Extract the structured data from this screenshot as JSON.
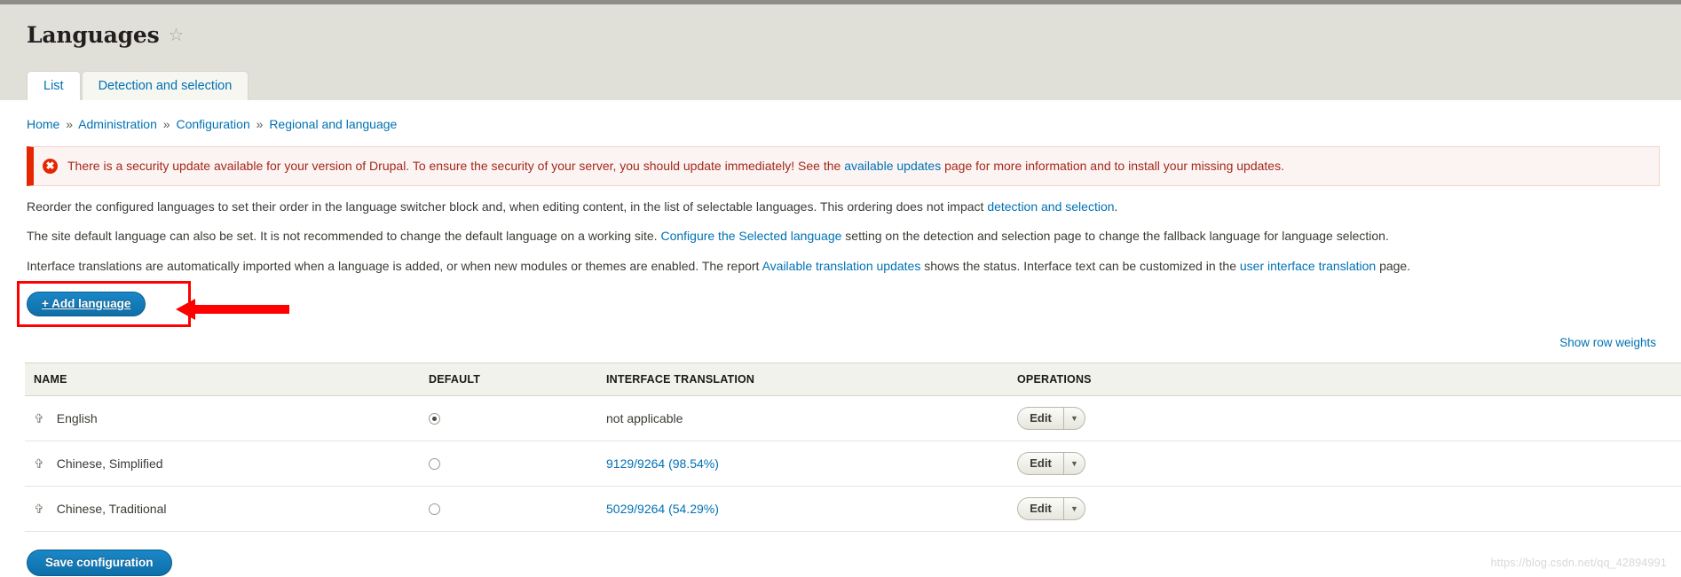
{
  "header": {
    "title": "Languages",
    "star_icon": "star-outline-icon"
  },
  "tabs": [
    {
      "label": "List",
      "active": true
    },
    {
      "label": "Detection and selection",
      "active": false
    }
  ],
  "breadcrumb": {
    "items": [
      "Home",
      "Administration",
      "Configuration",
      "Regional and language"
    ],
    "separator": "»"
  },
  "message": {
    "icon": "error-icon",
    "text_before": "There is a security update available for your version of Drupal. To ensure the security of your server, you should update immediately! See the ",
    "link": "available updates",
    "text_after": " page for more information and to install your missing updates."
  },
  "paragraphs": {
    "p1_before": "Reorder the configured languages to set their order in the language switcher block and, when editing content, in the list of selectable languages. This ordering does not impact ",
    "p1_link": "detection and selection",
    "p1_after": ".",
    "p2_before": "The site default language can also be set. It is not recommended to change the default language on a working site. ",
    "p2_link": "Configure the Selected language",
    "p2_after": " setting on the detection and selection page to change the fallback language for language selection.",
    "p3_before": "Interface translations are automatically imported when a language is added, or when new modules or themes are enabled. The report ",
    "p3_link1": "Available translation updates",
    "p3_middle": " shows the status. Interface text can be customized in the ",
    "p3_link2": "user interface translation",
    "p3_after": " page."
  },
  "add_language_button": {
    "label": "+ Add language"
  },
  "annotation": {
    "box_color": "#fe0000",
    "arrow_color": "#fe0000"
  },
  "show_row_weights": "Show row weights",
  "table": {
    "columns": [
      "NAME",
      "DEFAULT",
      "INTERFACE TRANSLATION",
      "OPERATIONS"
    ],
    "rows": [
      {
        "drag_icon": "drag-handle-icon",
        "name": "English",
        "default_selected": true,
        "translation": "not applicable",
        "translation_is_link": false,
        "edit_label": "Edit",
        "dropdown_icon": "chevron-down-icon"
      },
      {
        "drag_icon": "drag-handle-icon",
        "name": "Chinese, Simplified",
        "default_selected": false,
        "translation": "9129/9264 (98.54%)",
        "translation_is_link": true,
        "edit_label": "Edit",
        "dropdown_icon": "chevron-down-icon"
      },
      {
        "drag_icon": "drag-handle-icon",
        "name": "Chinese, Traditional",
        "default_selected": false,
        "translation": "5029/9264 (54.29%)",
        "translation_is_link": true,
        "edit_label": "Edit",
        "dropdown_icon": "chevron-down-icon"
      }
    ]
  },
  "save_button": {
    "label": "Save configuration"
  },
  "watermark": "https://blog.csdn.net/qq_42894991"
}
